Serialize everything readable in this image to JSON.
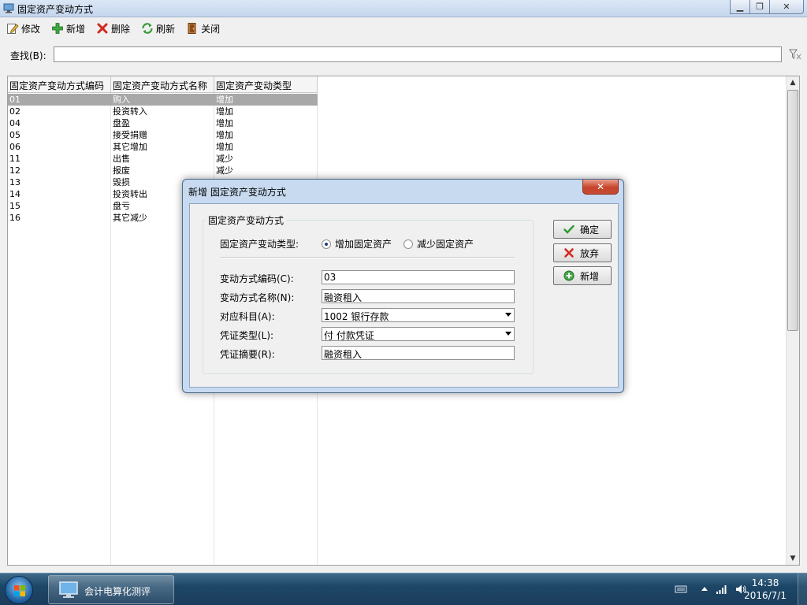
{
  "window": {
    "title": "固定资产变动方式",
    "min_symbol": "▁",
    "max_symbol": "❐",
    "close_symbol": "✕"
  },
  "toolbar": {
    "edit_label": "修改",
    "add_label": "新增",
    "delete_label": "删除",
    "refresh_label": "刷新",
    "close_label": "关闭"
  },
  "search": {
    "label": "查找(B):",
    "value": ""
  },
  "grid": {
    "columns": [
      "固定资产变动方式编码",
      "固定资产变动方式名称",
      "固定资产变动类型"
    ],
    "rows": [
      {
        "code": "01",
        "name": "购入",
        "type": "增加"
      },
      {
        "code": "02",
        "name": "投资转入",
        "type": "增加"
      },
      {
        "code": "04",
        "name": "盘盈",
        "type": "增加"
      },
      {
        "code": "05",
        "name": "接受捐赠",
        "type": "增加"
      },
      {
        "code": "06",
        "name": "其它增加",
        "type": "增加"
      },
      {
        "code": "11",
        "name": "出售",
        "type": "减少"
      },
      {
        "code": "12",
        "name": "报废",
        "type": "减少"
      },
      {
        "code": "13",
        "name": "毁损",
        "type": ""
      },
      {
        "code": "14",
        "name": "投资转出",
        "type": ""
      },
      {
        "code": "15",
        "name": "盘亏",
        "type": ""
      },
      {
        "code": "16",
        "name": "其它减少",
        "type": ""
      }
    ],
    "selected_index": 0
  },
  "dialog": {
    "title": "新增 固定资产变动方式",
    "close_symbol": "✕",
    "group_title": "固定资产变动方式",
    "type_label": "固定资产变动类型:",
    "radio_increase": "增加固定资产",
    "radio_decrease": "减少固定资产",
    "selected_radio": "increase",
    "code_label": "变动方式编码(C):",
    "code_value": "03",
    "name_label": "变动方式名称(N):",
    "name_value": "融资租入",
    "account_label": "对应科目(A):",
    "account_value": "1002   银行存款",
    "voucher_label": "凭证类型(L):",
    "voucher_value": "付   付款凭证",
    "summary_label": "凭证摘要(R):",
    "summary_value": "融资租入",
    "ok_label": "确定",
    "cancel_label": "放弃",
    "new_label": "新增"
  },
  "taskbar": {
    "task_label": "会计电算化测评",
    "time": "14:38",
    "date": "2016/7/1"
  },
  "colors": {
    "selected_row": "#a8a8a8",
    "dialog_frame": "#c7daf0",
    "taskbar": "#1d4667"
  }
}
